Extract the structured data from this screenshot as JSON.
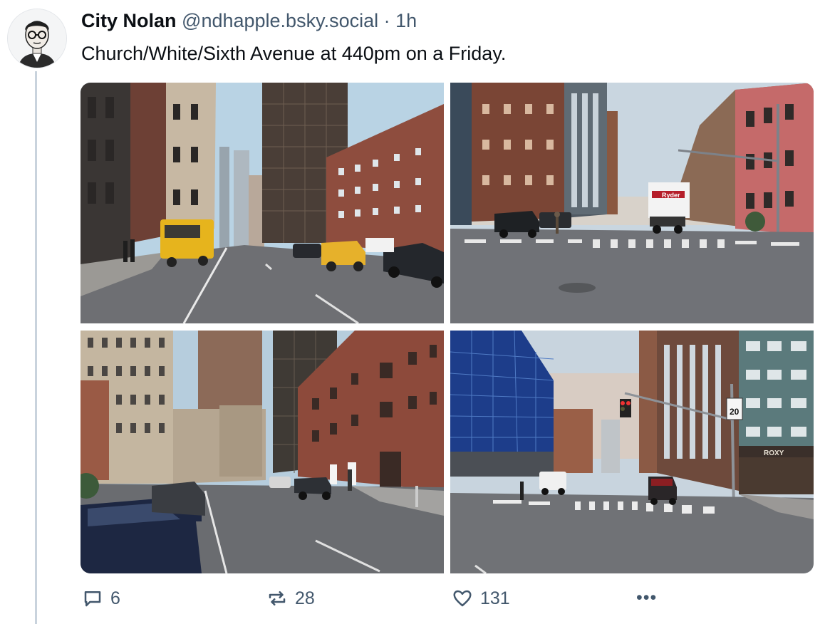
{
  "post": {
    "author_name": "City Nolan",
    "handle": "@ndhapple.bsky.social",
    "separator": "·",
    "time": "1h",
    "text": "Church/White/Sixth Avenue at 440pm on a Friday."
  },
  "photos": [
    {
      "alt": "Church Street looking south with yellow truck and taxi"
    },
    {
      "alt": "Intersection crosswalk with Ryder truck"
    },
    {
      "alt": "Brick buildings along street with parked cars"
    },
    {
      "alt": "Sixth Avenue with blue scaffolding and Roxy hotel"
    }
  ],
  "signs": {
    "roxy": "ROXY",
    "truck": "Ryder",
    "speed": "20"
  },
  "actions": {
    "replies": "6",
    "reposts": "28",
    "likes": "131",
    "more": "•••"
  },
  "colors": {
    "text": "#0b0f14",
    "muted": "#42576c",
    "thread": "#c9d3dd"
  }
}
